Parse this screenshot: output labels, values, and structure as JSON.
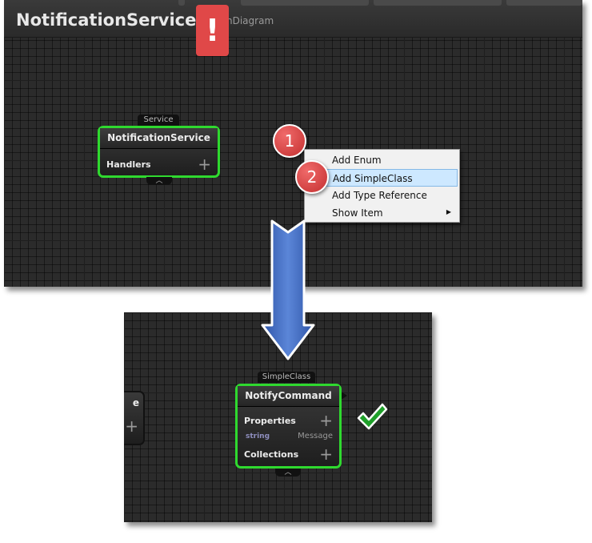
{
  "top_window": {
    "title": "NotificationService",
    "subtitle": "nDiagram",
    "warning_symbol": "!",
    "service_node": {
      "tag": "Service",
      "title": "NotificationService",
      "section": "Handlers",
      "plus": "+",
      "collapse": "︿"
    },
    "context_menu": {
      "items": [
        {
          "label": "Add Enum"
        },
        {
          "label": "Add SimpleClass"
        },
        {
          "label": "Add Type Reference"
        },
        {
          "label": "Show Item"
        }
      ],
      "submenu_arrow": "▶"
    },
    "step_badges": [
      "1",
      "2"
    ]
  },
  "bottom_window": {
    "partial_node": {
      "label_tail": "e",
      "plus": "+"
    },
    "class_node": {
      "tag": "SimpleClass",
      "title": "NotifyCommand",
      "properties_label": "Properties",
      "property": {
        "type": "string",
        "name": "Message"
      },
      "collections_label": "Collections",
      "plus": "+",
      "collapse": "︿"
    }
  },
  "icons": {
    "warning": "warning-icon",
    "arrow": "arrow-down-icon",
    "check": "check-icon"
  },
  "colors": {
    "node_border": "#2fd92f",
    "badge": "#d43c3c",
    "arrow": "#3f6bc4",
    "check": "#1fa02a",
    "warning": "#e04848"
  }
}
